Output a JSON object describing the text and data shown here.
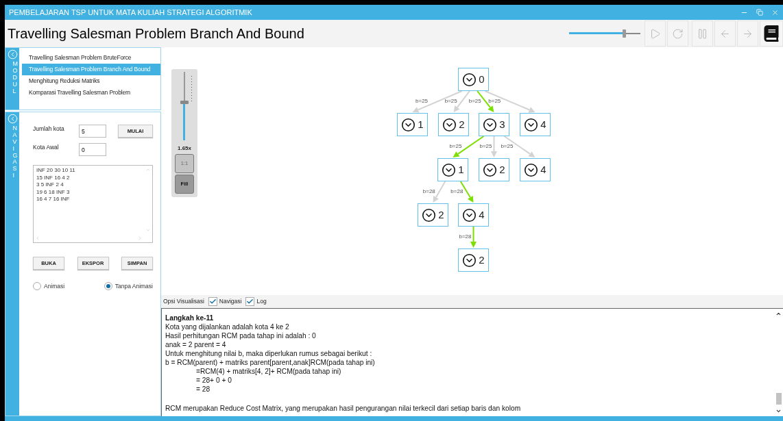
{
  "window": {
    "title": "PEMBELAJARAN TSP UNTUK MATA KULIAH STRATEGI ALGORITMIK"
  },
  "header": {
    "title": "Travelling Salesman Problem Branch And Bound",
    "speed": {
      "level": 0.77
    }
  },
  "modul": {
    "label": "MODUL",
    "items": [
      {
        "label": "Travelling Salesman Problem BruteForce",
        "selected": false
      },
      {
        "label": "Travelling Salesman Problem Branch And Bound",
        "selected": true
      },
      {
        "label": "Menghitung Reduksi Matriks",
        "selected": false
      },
      {
        "label": "Komparasi Travelling Salesman Problem",
        "selected": false
      }
    ]
  },
  "navigasi": {
    "label": "NAVIGASI",
    "fields": [
      {
        "label": "Jumlah kota",
        "value": "5"
      },
      {
        "label": "Kota Awal",
        "value": "0"
      }
    ],
    "start_button": "MULAI",
    "matrix": [
      "INF 20 30 10 11",
      "15 INF 16 4 2",
      "3 5 INF 2 4",
      "19 6 18 INF 3",
      "16 4 7 16 INF"
    ],
    "buttons": [
      "BUKA",
      "EKSPOR",
      "SIMPAN"
    ],
    "modes": [
      {
        "label": "Animasi",
        "selected": false
      },
      {
        "label": "Tanpa Animasi",
        "selected": true
      }
    ]
  },
  "zoom": {
    "level": 0.55,
    "reading": "1.65x",
    "buttons": [
      {
        "label": "1:1",
        "selected": false
      },
      {
        "label": "Fill",
        "selected": true
      }
    ]
  },
  "tree": {
    "label": "0",
    "children": [
      {
        "label": "1",
        "bound": "b=25",
        "on_path": false
      },
      {
        "label": "2",
        "bound": "b=25",
        "on_path": false
      },
      {
        "label": "3",
        "bound": "b=25",
        "on_path": true,
        "children": [
          {
            "label": "1",
            "bound": "b=25",
            "on_path": true,
            "children": [
              {
                "label": "2",
                "bound": "b=28",
                "on_path": false
              },
              {
                "label": "4",
                "bound": "b=28",
                "on_path": true,
                "children": [
                  {
                    "label": "2",
                    "bound": "b=28",
                    "on_path": true
                  }
                ]
              }
            ]
          },
          {
            "label": "2",
            "bound": "b=25",
            "on_path": false
          },
          {
            "label": "4",
            "bound": "b=25",
            "on_path": false
          }
        ]
      },
      {
        "label": "4",
        "bound": "b=25",
        "on_path": false
      }
    ]
  },
  "options": {
    "label": "Opsi Visualisasi",
    "items": [
      {
        "label": "Navigasi",
        "checked": true
      },
      {
        "label": "Log",
        "checked": true
      }
    ]
  },
  "log": [
    {
      "kind": "heading",
      "text": "Langkah ke-11"
    },
    {
      "kind": "text",
      "text": "Kota yang dijalankan adalah kota 4 ke 2"
    },
    {
      "kind": "text",
      "text": "Hasil perhitungan RCM pada tahap ini adalah : 0"
    },
    {
      "kind": "text",
      "text": "anak = 2 parent = 4"
    },
    {
      "kind": "text",
      "text": "Untuk menghitung nilai b, maka diperlukan rumus sebagai berikut :"
    },
    {
      "kind": "text",
      "text": "b = RCM(parent) + matriks parent[parent,anak]RCM(pada tahap ini)"
    },
    {
      "kind": "indent",
      "text": "=RCM(4) + matriks[4, 2]+ RCM(pada tahap ini)"
    },
    {
      "kind": "indent",
      "text": "= 28+ 0 + 0"
    },
    {
      "kind": "indent",
      "text": "= 28"
    },
    {
      "kind": "note",
      "text": "RCM merupakan Reduce Cost Matrix, yang merupakan hasil pengurangan nilai terkecil dari setiap baris dan kolom"
    }
  ]
}
